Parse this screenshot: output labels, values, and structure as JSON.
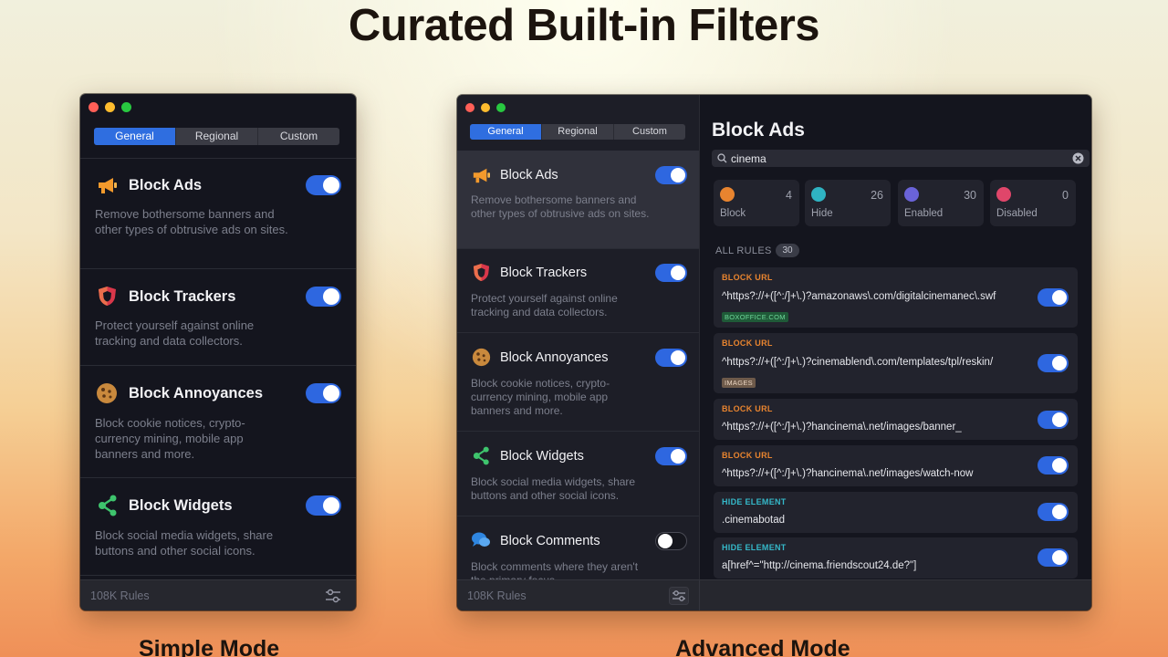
{
  "headline": "Curated Built-in Filters",
  "captions": {
    "simple": "Simple Mode",
    "advanced": "Advanced Mode"
  },
  "tabs": [
    "General",
    "Regional",
    "Custom"
  ],
  "filters": [
    {
      "title": "Block Ads",
      "desc": "Remove bothersome banners and other types of obtrusive ads on sites.",
      "enabled": true,
      "icon": "megaphone-icon"
    },
    {
      "title": "Block Trackers",
      "desc": "Protect yourself against online tracking and data collectors.",
      "enabled": true,
      "icon": "shield-icon"
    },
    {
      "title": "Block Annoyances",
      "desc": "Block cookie notices, crypto-currency mining, mobile app banners and more.",
      "enabled": true,
      "icon": "cookie-icon"
    },
    {
      "title": "Block Widgets",
      "desc": "Block social media widgets, share buttons and other social icons.",
      "enabled": true,
      "icon": "share-icon"
    },
    {
      "title": "Block Comments",
      "desc": "Block comments where they aren't the primary focus.",
      "enabled": false,
      "icon": "speech-bubbles-icon"
    }
  ],
  "footer": {
    "rules_count": "108K Rules"
  },
  "detail": {
    "title": "Block Ads",
    "search_value": "cinema",
    "stats": [
      {
        "label": "Block",
        "count": "4",
        "icon": "hand-icon",
        "color": "#e8842f"
      },
      {
        "label": "Hide",
        "count": "26",
        "icon": "eye-icon",
        "color": "#2fb3c2"
      },
      {
        "label": "Enabled",
        "count": "30",
        "icon": "toggle-on-icon",
        "color": "#6a63d8"
      },
      {
        "label": "Disabled",
        "count": "0",
        "icon": "toggle-off-icon",
        "color": "#e0466a"
      }
    ],
    "all_rules_label": "ALL RULES",
    "all_rules_count": "30",
    "rules": [
      {
        "type": "BLOCK URL",
        "pattern": "^https?://+([^:/]+\\.)?amazonaws\\.com/digitalcinemanec\\.swf",
        "tag": "BOXOFFICE.COM",
        "tag_kind": "domain"
      },
      {
        "type": "BLOCK URL",
        "pattern": "^https?://+([^:/]+\\.)?cinemablend\\.com/templates/tpl/reskin/",
        "tag": "IMAGES",
        "tag_kind": "resource"
      },
      {
        "type": "BLOCK URL",
        "pattern": "^https?://+([^:/]+\\.)?hancinema\\.net/images/banner_",
        "tag": "",
        "tag_kind": ""
      },
      {
        "type": "BLOCK URL",
        "pattern": "^https?://+([^:/]+\\.)?hancinema\\.net/images/watch-now",
        "tag": "",
        "tag_kind": ""
      },
      {
        "type": "HIDE ELEMENT",
        "pattern": ".cinemabotad",
        "tag": "",
        "tag_kind": ""
      },
      {
        "type": "HIDE ELEMENT",
        "pattern": "a[href^=\"http://cinema.friendscout24.de?\"]",
        "tag": "",
        "tag_kind": ""
      }
    ]
  },
  "colors": {
    "accent": "#2f6ee0",
    "block_url": "#e8842f",
    "hide_element": "#35b8c9",
    "domain_tag_bg": "#1f5a38",
    "domain_tag_fg": "#6fd79a",
    "resource_tag_bg": "#6e5a4a",
    "resource_tag_fg": "#e8d3c0"
  }
}
